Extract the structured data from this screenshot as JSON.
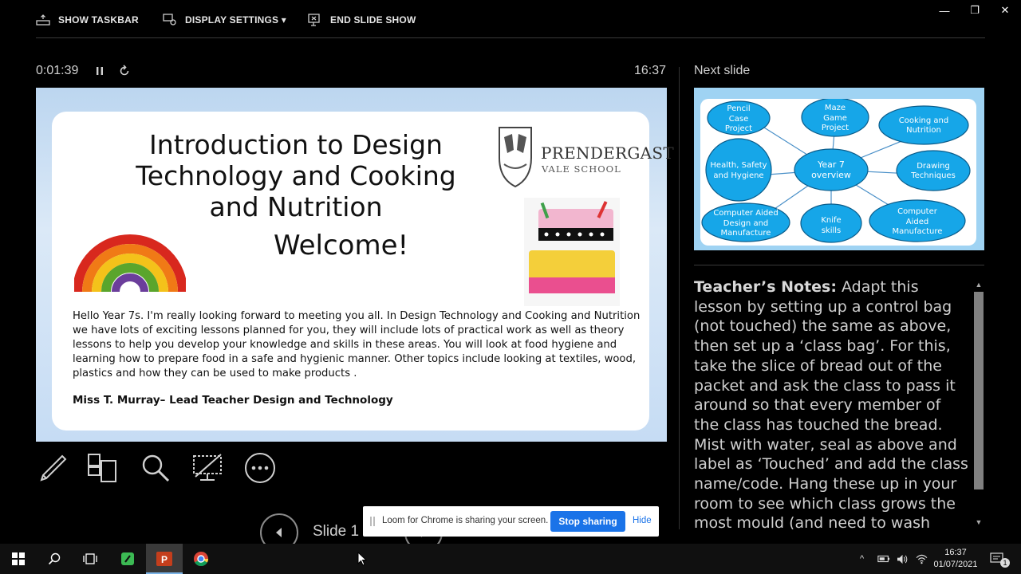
{
  "toolbar": {
    "show_taskbar": "SHOW TASKBAR",
    "display_settings": "DISPLAY SETTINGS ▾",
    "end_slide_show": "END SLIDE SHOW"
  },
  "presenter": {
    "elapsed": "0:01:39",
    "clock": "16:37",
    "next_slide_label": "Next slide",
    "slide_counter": "Slide 1"
  },
  "current_slide": {
    "title": "Introduction to Design Technology and Cooking and Nutrition",
    "welcome": "Welcome!",
    "school_name": "PRENDERGAST",
    "school_sub": "VALE SCHOOL",
    "body": "Hello Year 7s.  I'm really looking forward to meeting you all.  In Design Technology and Cooking and Nutrition we have lots of exciting lessons planned for you, they will include lots of practical work as well as theory lessons to help you develop your knowledge and skills in these areas.  You will look at food hygiene and learning how to prepare food in a safe and hygienic manner.  Other topics include looking at textiles, wood, plastics and  how they can be used to  make products .",
    "signature": "Miss T. Murray– Lead Teacher Design and Technology"
  },
  "next_slide": {
    "center": "Year 7 overview",
    "nodes": [
      "Pencil Case Project",
      "Maze Game Project",
      "Cooking and Nutrition",
      "Health, Safety and Hygiene",
      "Drawing Techniques",
      "Computer Aided Design and Manufacture",
      "Knife skills",
      "Computer Aided Manufacture"
    ]
  },
  "notes": {
    "heading": "Teacher’s Notes:",
    "text": " Adapt this lesson by setting up a control bag (not touched) the same as above, then set up a ‘class bag’. For this, take the slice of bread out of the packet and ask the class to pass it around so that every member of the class has touched the bread. Mist with water, seal as above and label as ‘Touched’ and add the class name/code. Hang these up in your room to see which class grows the most mould (and need to wash their hands more"
  },
  "loom": {
    "message": "Loom for Chrome is sharing your screen.",
    "stop": "Stop sharing",
    "hide": "Hide"
  },
  "taskbar": {
    "time": "16:37",
    "date": "01/07/2021",
    "notification_count": "1"
  }
}
